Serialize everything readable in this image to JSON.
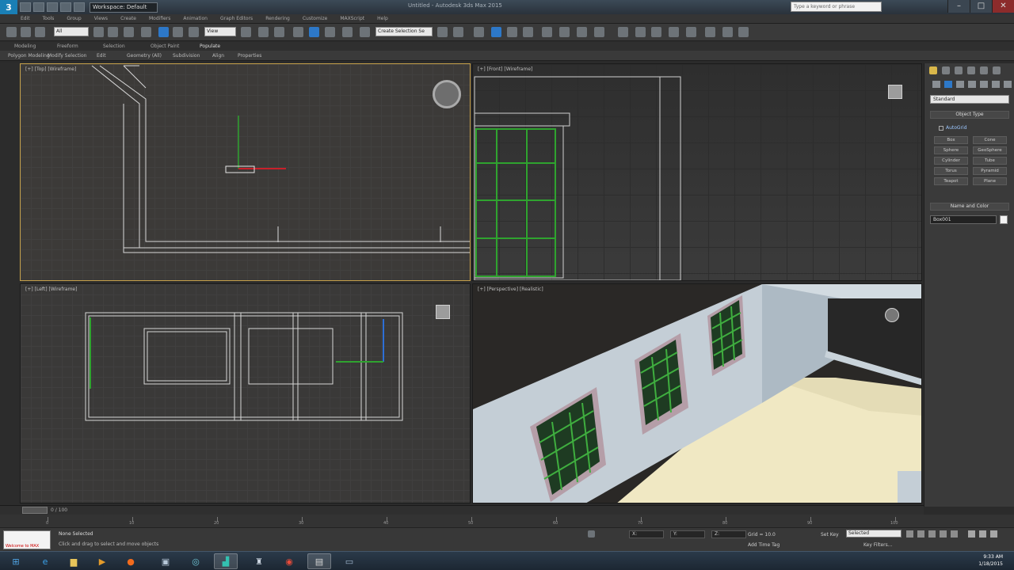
{
  "titlebar": {
    "logo": "3",
    "workspace": "Workspace: Default",
    "title": "Untitled - Autodesk 3ds Max 2015",
    "help_search": "Type a keyword or phrase",
    "min": "–",
    "max": "□",
    "close": "✕"
  },
  "menubar": {
    "items": [
      "Edit",
      "Tools",
      "Group",
      "Views",
      "Create",
      "Modifiers",
      "Animation",
      "Graph Editors",
      "Rendering",
      "Customize",
      "MAXScript",
      "Help"
    ]
  },
  "toolbar": {
    "selection_filter": "All",
    "ref_coord": "View",
    "named_selection": "Create Selection Se"
  },
  "ribbon": {
    "tabs": [
      "Modeling",
      "Freeform",
      "Selection",
      "Object Paint",
      "Populate"
    ],
    "sub_items": [
      "Polygon Modeling",
      "Modify Selection",
      "Edit",
      "Geometry (All)",
      "Subdivision",
      "Align",
      "Properties"
    ]
  },
  "viewports": {
    "top_label": "[+] [Top] [Wireframe]",
    "front_label": "[+] [Front] [Wireframe]",
    "left_label": "[+] [Left] [Wireframe]",
    "persp_label": "[+] [Perspective] [Realistic]"
  },
  "command_panel": {
    "dropdown": "Standard",
    "object_type_title": "Object Type",
    "autogrid": "AutoGrid",
    "buttons": [
      "Box",
      "Cone",
      "Sphere",
      "GeoSphere",
      "Cylinder",
      "Tube",
      "Torus",
      "Pyramid",
      "Teapot",
      "Plane"
    ],
    "name_color_title": "Name and Color",
    "name_value": "Box001"
  },
  "timeline": {
    "frame_label": "0 / 100",
    "ticks": [
      "0",
      "10",
      "20",
      "30",
      "40",
      "50",
      "60",
      "70",
      "80",
      "90",
      "100"
    ]
  },
  "status": {
    "maxscript": "Welcome to MAX",
    "line1": "None Selected",
    "line2": "Click and drag to select and move objects",
    "x_field": "X:",
    "y_field": "Y:",
    "z_field": "Z:",
    "grid_field": "Grid = 10.0",
    "auto_key": "Selected",
    "add_time_tag": "Add Time Tag",
    "set_key": "Set Key",
    "key_filters": "Key Filters..."
  },
  "taskbar": {
    "time": "9:33 AM",
    "date": "1/18/2015"
  },
  "colors": {
    "active_viewport_border": "#c6a04a",
    "window_bars": "#2fa32f",
    "wireframe": "#d8d8d8",
    "brand_blue": "#1a7fb5"
  }
}
